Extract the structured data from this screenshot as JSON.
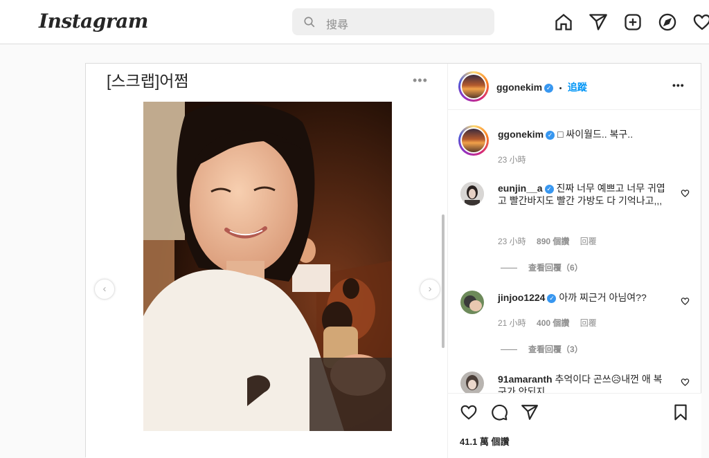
{
  "header": {
    "logo": "Instagram",
    "search_placeholder": "搜尋"
  },
  "post": {
    "title": "[스크랩]어쩜",
    "more": "•••",
    "prev": "‹",
    "next": "›"
  },
  "author": {
    "username": "ggonekim",
    "separator": "•",
    "follow_label": "追蹤",
    "more": "•••"
  },
  "caption": {
    "username": "ggonekim",
    "text": "□ 싸이월드.. 복구..",
    "time": "23 小時"
  },
  "comments": [
    {
      "username": "eunjin__a",
      "text": "진짜 너무 예쁘고 너무 귀엽고 빨간바지도 빨간 가방도 다 기억나고,,,",
      "time": "23 小時",
      "likes": "890 個讚",
      "reply": "回覆",
      "view_replies": "查看回覆（6）"
    },
    {
      "username": "jinjoo1224",
      "text": "아까 찌근거 아님여??",
      "time": "21 小時",
      "likes": "400 個讚",
      "reply": "回覆",
      "view_replies": "查看回覆（3）"
    },
    {
      "username": "91amaranth",
      "text": "추억이다 곤쓰😥내껀 애 복구가 안되지"
    }
  ],
  "footer": {
    "likes": "41.1 萬 個讚"
  },
  "colors": {
    "accent": "#0095f6",
    "verified": "#3897f0"
  }
}
